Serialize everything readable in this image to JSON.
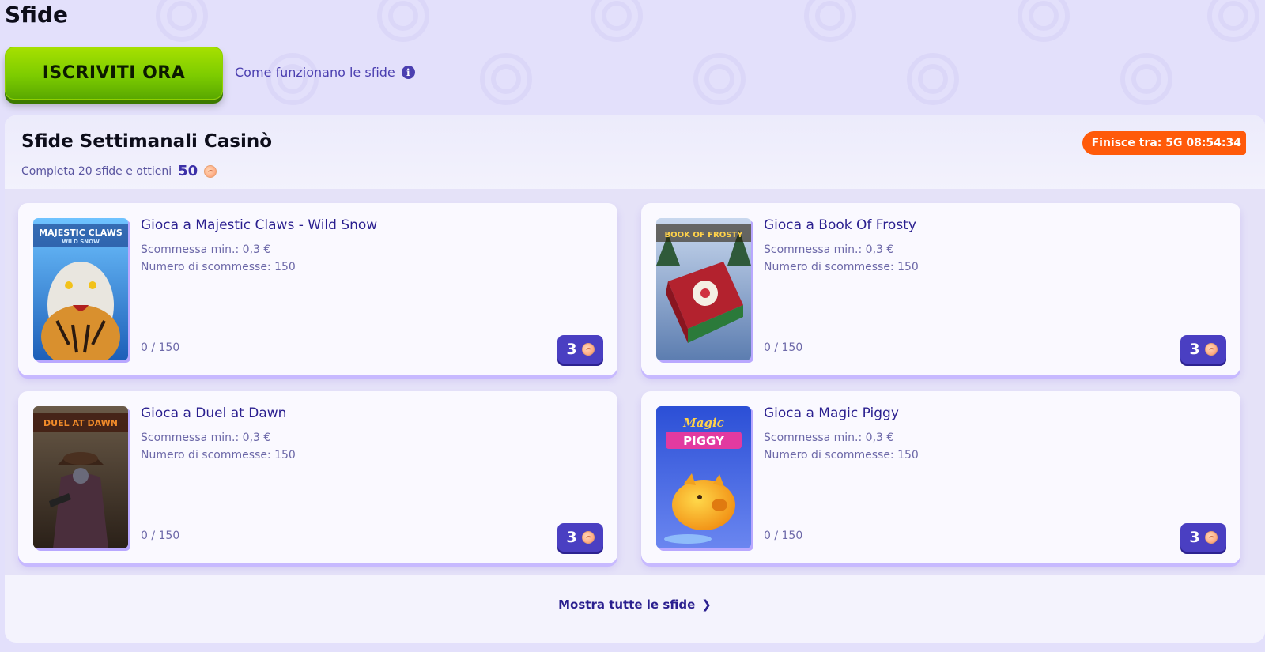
{
  "page": {
    "title": "Sfide",
    "join_button": "ISCRIVITI ORA",
    "how_link": "Come funzionano le sfide",
    "info_icon": "info-icon"
  },
  "weekly": {
    "title": "Sfide Settimanali Casinò",
    "subtitle": "Completa 20 sfide e ottieni",
    "reward": "50",
    "timer": "Finisce tra: 5G 08:54:34",
    "show_all": "Mostra tutte le sfide",
    "show_all_icon": "chevron-right-icon"
  },
  "challenges": [
    {
      "title": "Gioca a Majestic Claws - Wild Snow",
      "min_bet": "Scommessa min.: 0,3 €",
      "num_bets": "Numero di scommesse: 150",
      "progress": "0 / 150",
      "reward": "3",
      "thumb_title": "MAJESTIC CLAWS",
      "thumb_subtitle": "WILD SNOW"
    },
    {
      "title": "Gioca a Book Of Frosty",
      "min_bet": "Scommessa min.: 0,3 €",
      "num_bets": "Numero di scommesse: 150",
      "progress": "0 / 150",
      "reward": "3",
      "thumb_title": "BOOK OF FROSTY"
    },
    {
      "title": "Gioca a Duel at Dawn",
      "min_bet": "Scommessa min.: 0,3 €",
      "num_bets": "Numero di scommesse: 150",
      "progress": "0 / 150",
      "reward": "3",
      "thumb_title": "DUEL AT DAWN"
    },
    {
      "title": "Gioca a Magic Piggy",
      "min_bet": "Scommessa min.: 0,3 €",
      "num_bets": "Numero di scommesse: 150",
      "progress": "0 / 150",
      "reward": "3",
      "thumb_title": "Magic",
      "thumb_subtitle": "PIGGY"
    }
  ],
  "colors": {
    "accent": "#4a3fc2",
    "timer": "#ff5a0a",
    "join": "#7dcc00",
    "background": "#e3e0fb"
  }
}
